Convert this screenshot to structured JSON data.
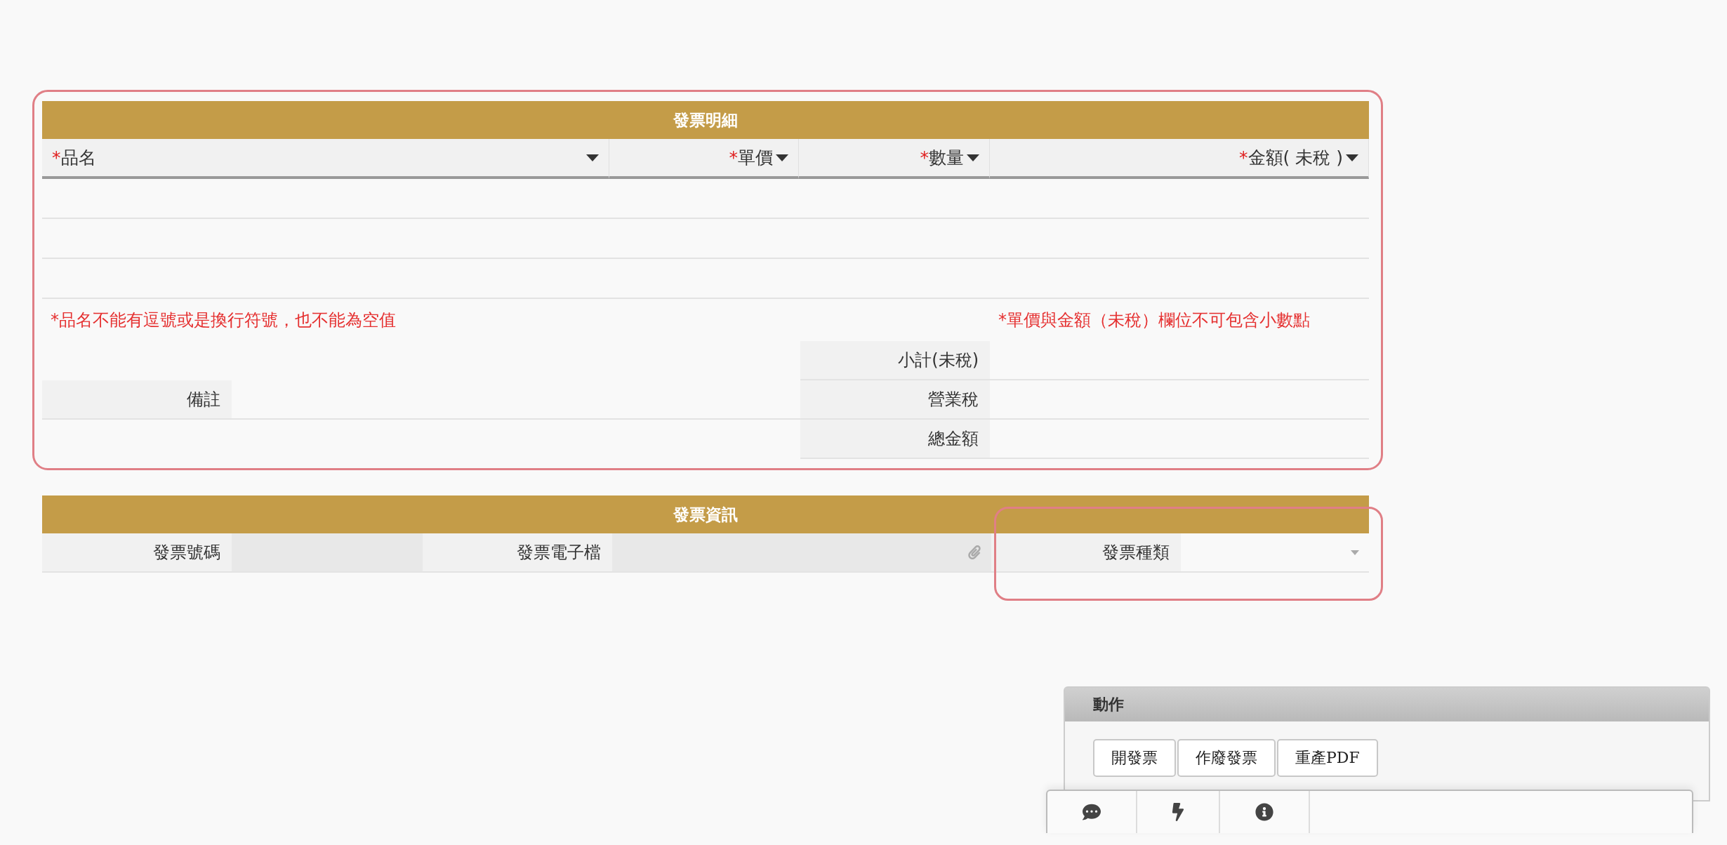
{
  "detail": {
    "title": "發票明細",
    "columns": [
      {
        "mark": "*",
        "label": "品名",
        "kind": "text"
      },
      {
        "mark": "*",
        "label": "單價",
        "kind": "number"
      },
      {
        "mark": "*",
        "label": "數量",
        "kind": "number"
      },
      {
        "mark": "*",
        "label": "金額( 未稅 )",
        "kind": "number"
      }
    ],
    "notes": [
      "*品名不能有逗號或是換行符號，也不能為空值",
      "*單價與金額（未稅）欄位不可包含小數點"
    ],
    "remark": {
      "label": "備註"
    },
    "summary": [
      {
        "label": "小計(未稅)"
      },
      {
        "label": "營業稅"
      },
      {
        "label": "總金額"
      }
    ]
  },
  "info": {
    "title": "發票資訊",
    "fields": [
      {
        "label": "發票號碼",
        "kind": "text"
      },
      {
        "label": "發票電子檔",
        "kind": "file"
      },
      {
        "label": "發票種類",
        "kind": "select"
      }
    ]
  },
  "actions": {
    "title": "動作",
    "buttons": [
      "開發票",
      "作廢發票",
      "重產PDF"
    ]
  }
}
